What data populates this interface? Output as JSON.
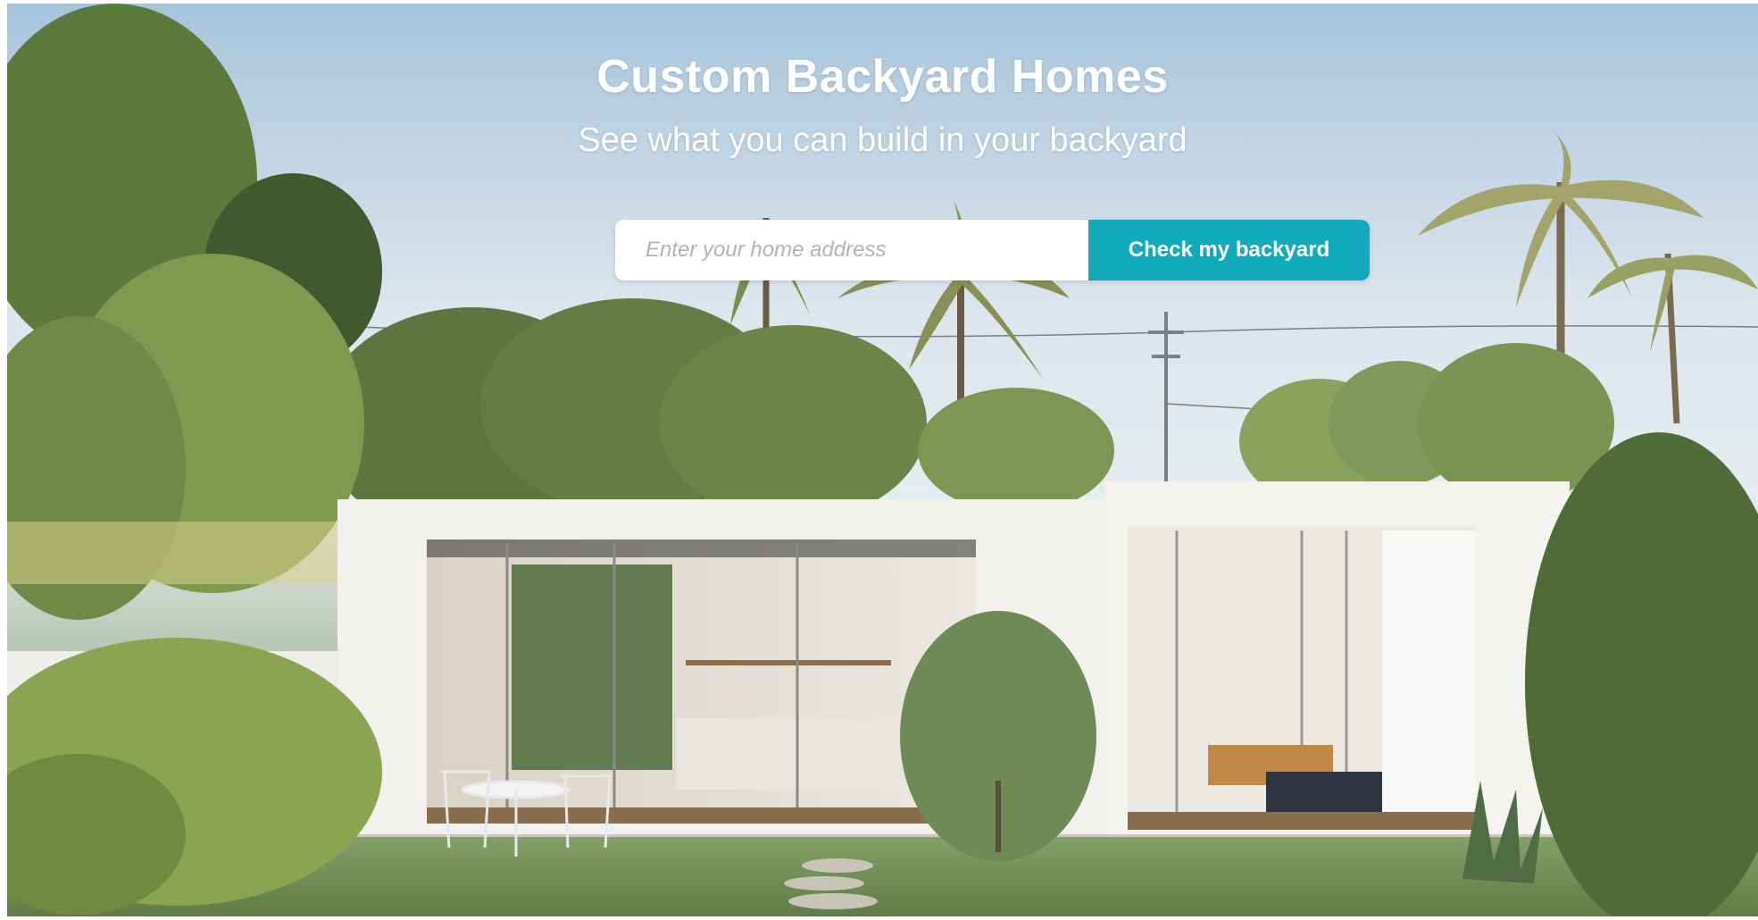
{
  "hero": {
    "title": "Custom Backyard Homes",
    "subtitle": "See what you can build in your backyard"
  },
  "search": {
    "placeholder": "Enter your home address",
    "button_label": "Check my backyard"
  },
  "colors": {
    "accent": "#10aabb",
    "title_text": "#ffffff"
  }
}
